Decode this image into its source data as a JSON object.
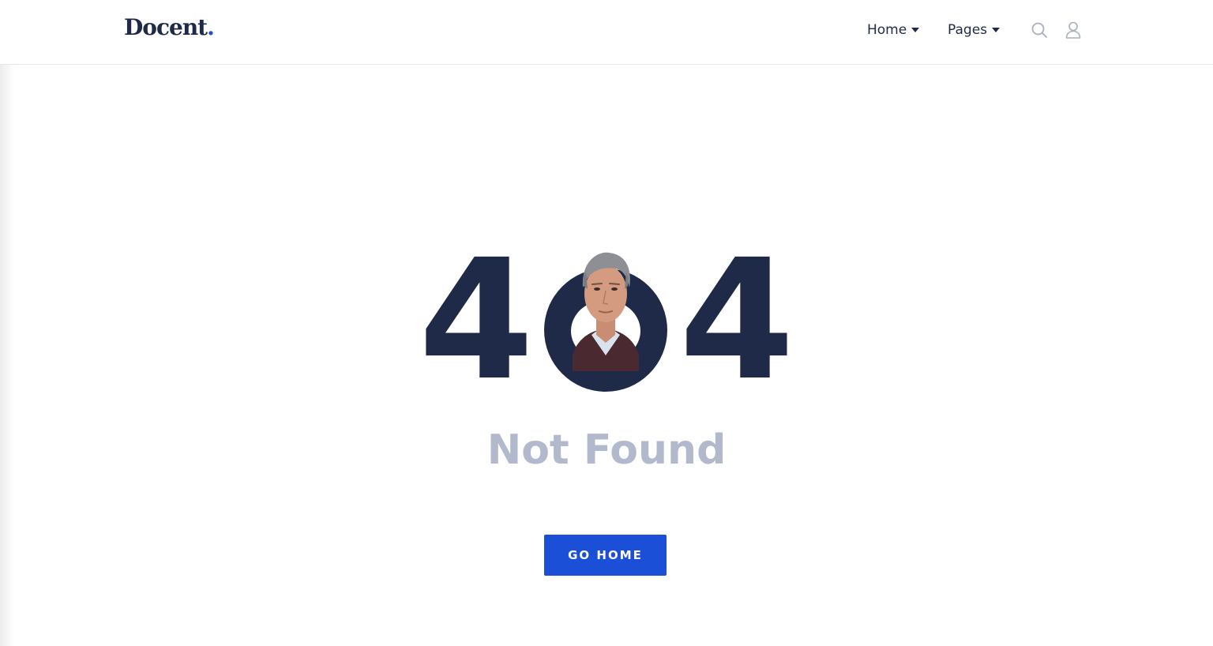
{
  "header": {
    "logo_text": "Docent",
    "logo_dot": ".",
    "nav": [
      {
        "label": "Home",
        "icon": "caret-down-icon"
      },
      {
        "label": "Pages",
        "icon": "caret-down-icon"
      }
    ],
    "actions": [
      {
        "icon": "search-icon"
      },
      {
        "icon": "user-icon"
      }
    ]
  },
  "hero": {
    "digit_left": "4",
    "digit_right": "4",
    "zero_image": "portrait-of-man",
    "subtitle": "Not Found"
  },
  "cta": {
    "label": "GO HOME"
  },
  "colors": {
    "navy": "#1f2a48",
    "accent": "#1c4fd8",
    "muted": "#b3b9cc"
  }
}
